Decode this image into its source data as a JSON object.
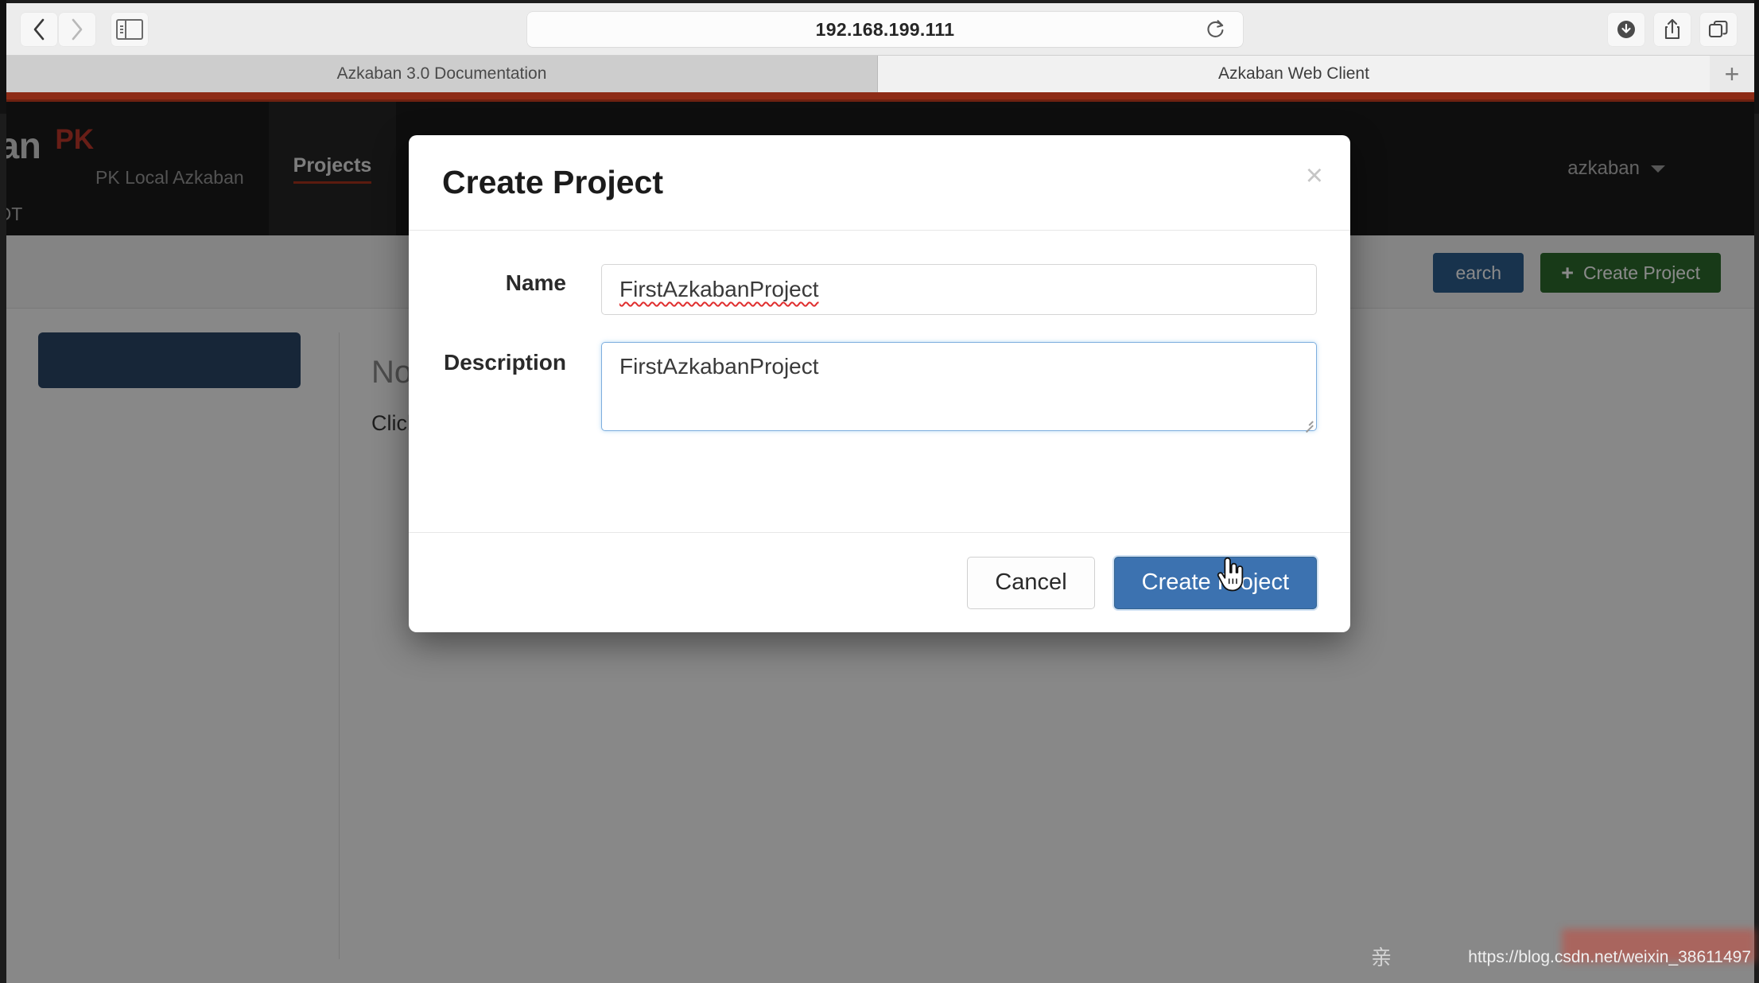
{
  "browser": {
    "url": "192.168.199.111",
    "back_icon": "back-chevron-icon",
    "forward_icon": "forward-chevron-icon",
    "sidebar_icon": "sidebar-toggle-icon",
    "reload_icon": "reload-icon",
    "downloads_icon": "downloads-icon",
    "share_icon": "share-icon",
    "tabs_overview_icon": "tab-overview-icon",
    "new_tab_label": "+",
    "tabs": [
      {
        "label": "Azkaban 3.0 Documentation",
        "active": false
      },
      {
        "label": "Azkaban Web Client",
        "active": true
      }
    ]
  },
  "app": {
    "logo": "aban",
    "logo_badge": "PK",
    "subtitle": "PK Local Azkaban",
    "secondary_label": "IOT",
    "nav_item": "Projects",
    "user_menu": "azkaban",
    "toolbar": {
      "search_label": "earch",
      "create_label": "Create Project",
      "plus_icon": "plus-icon"
    },
    "empty_state": {
      "title": "No V",
      "subtitle": "Click C"
    }
  },
  "modal": {
    "title": "Create Project",
    "close_icon": "close-icon",
    "name_label": "Name",
    "name_value": "FirstAzkabanProject",
    "description_label": "Description",
    "description_value": "FirstAzkabanProject",
    "cancel_label": "Cancel",
    "submit_label": "Create Project"
  },
  "watermark": {
    "cn_char": "亲",
    "url": "https://blog.csdn.net/weixin_38611497"
  },
  "colors": {
    "accent_blue": "#3c72b0",
    "create_green": "#2e6b2e",
    "search_blue": "#2e5f8f",
    "brand_red": "#c0392b",
    "nav_dark": "#1b1b1b",
    "sidebar_card": "#2b4668"
  }
}
